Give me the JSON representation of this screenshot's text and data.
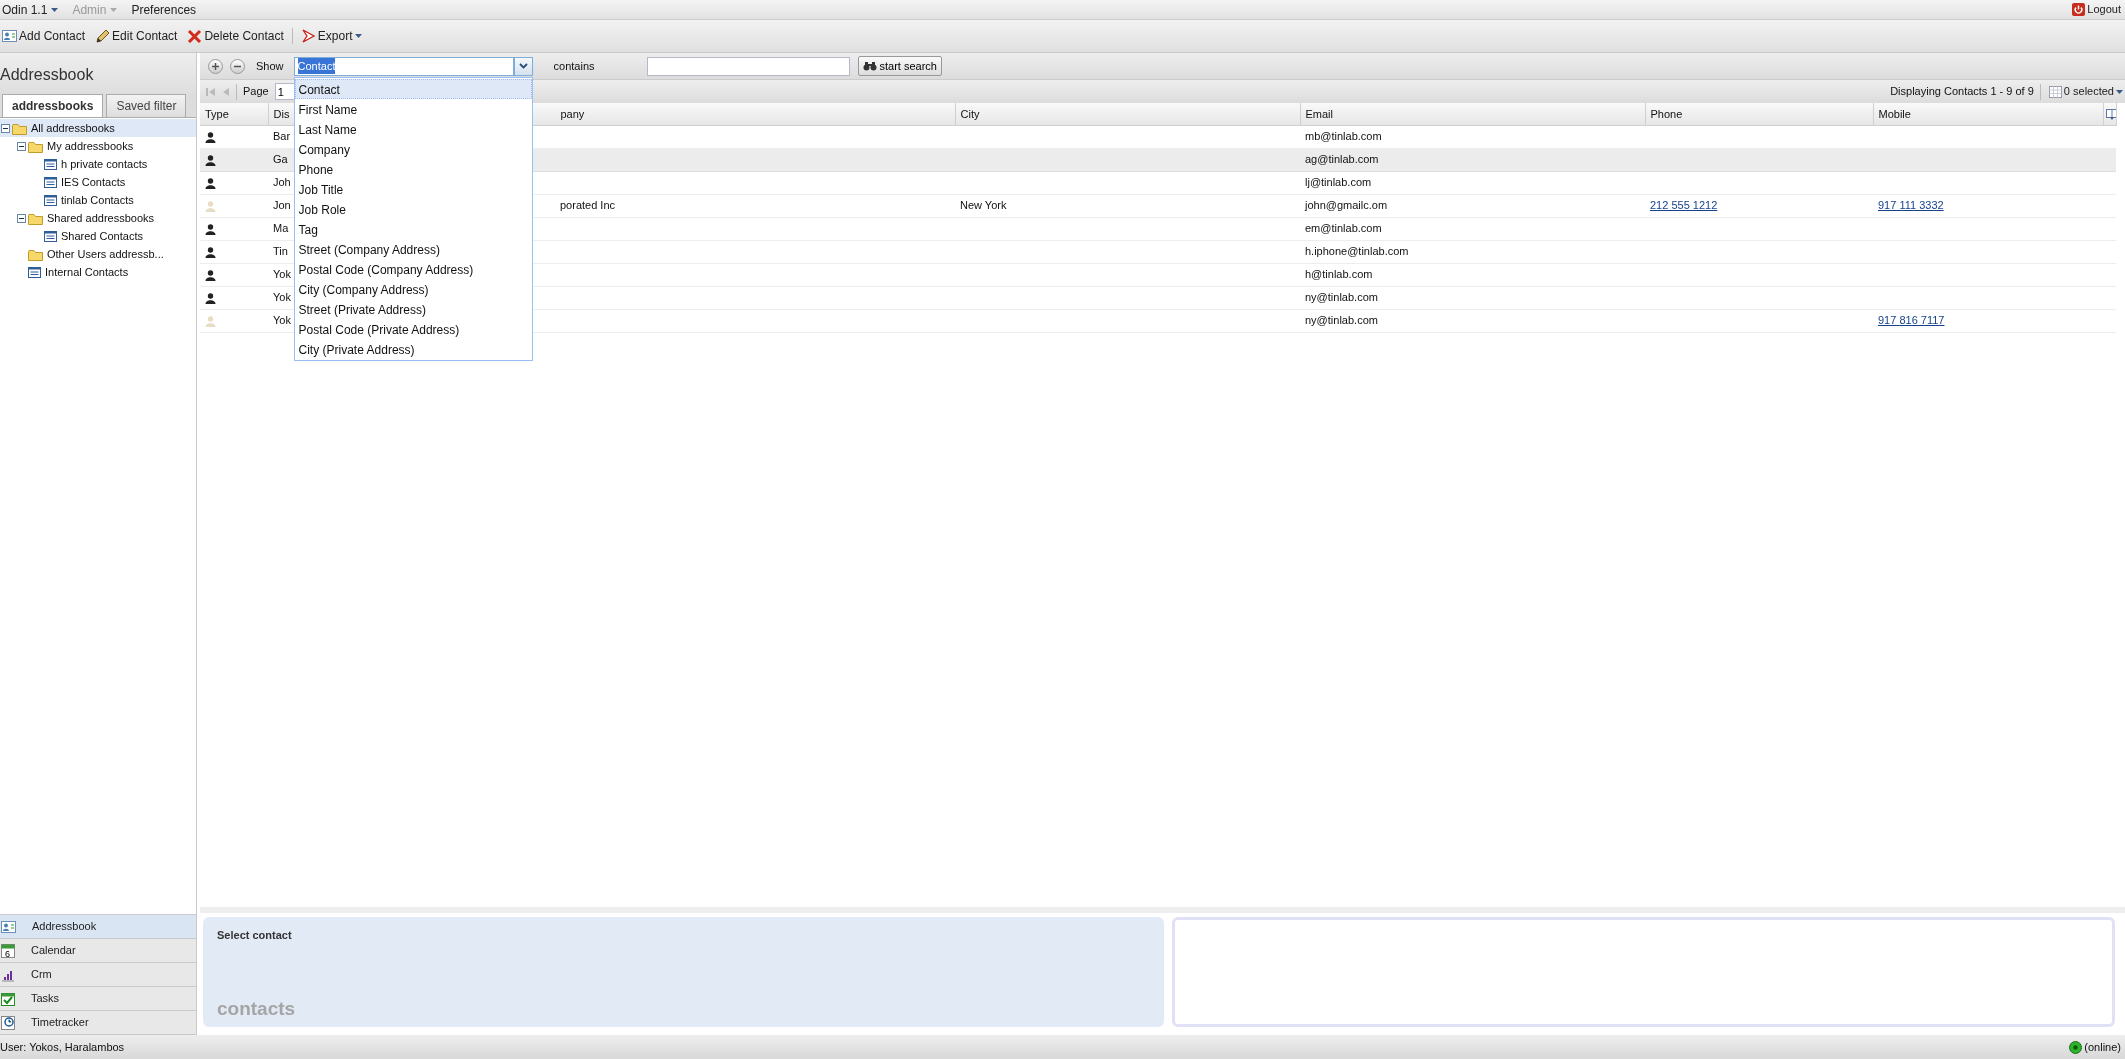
{
  "menu": [
    {
      "label": "Odin 1.1",
      "dropdown": true,
      "disabled": false
    },
    {
      "label": "Admin",
      "dropdown": true,
      "disabled": true
    },
    {
      "label": "Preferences",
      "dropdown": false,
      "disabled": false
    }
  ],
  "logout": "Logout",
  "toolbar": [
    {
      "kind": "add",
      "label": "Add Contact",
      "dropdown": false
    },
    {
      "kind": "edit",
      "label": "Edit Contact",
      "dropdown": false
    },
    {
      "kind": "delete",
      "label": "Delete Contact",
      "dropdown": false
    },
    {
      "kind": "export",
      "label": "Export",
      "dropdown": true
    }
  ],
  "sidebar": {
    "title": "Addressbook",
    "tabs": [
      {
        "label": "addressbooks",
        "selected": true
      },
      {
        "label": "Saved filter",
        "selected": false
      }
    ],
    "tree": [
      {
        "label": "All addressbooks",
        "kind": "folder",
        "expanded": true,
        "selected": true,
        "children": [
          {
            "label": "My addressbooks",
            "kind": "folder",
            "expanded": true,
            "selected": false,
            "children": [
              {
                "label": "h private contacts",
                "kind": "list",
                "selected": false
              },
              {
                "label": "IES Contacts",
                "kind": "list",
                "selected": false
              },
              {
                "label": "tinlab Contacts",
                "kind": "list",
                "selected": false
              }
            ]
          },
          {
            "label": "Shared addressbooks",
            "kind": "folder",
            "expanded": true,
            "selected": false,
            "children": [
              {
                "label": "Shared Contacts",
                "kind": "list",
                "selected": false
              }
            ]
          },
          {
            "label": "Other Users addressb...",
            "kind": "folder",
            "selected": false
          },
          {
            "label": "Internal Contacts",
            "kind": "list",
            "selected": false
          }
        ]
      }
    ],
    "modules": [
      {
        "kind": "addressbook",
        "label": "Addressbook",
        "selected": true
      },
      {
        "kind": "calendar",
        "label": "Calendar",
        "icon_text": "6",
        "selected": false
      },
      {
        "kind": "crm",
        "label": "Crm",
        "selected": false
      },
      {
        "kind": "tasks",
        "label": "Tasks",
        "selected": false
      },
      {
        "kind": "timetracker",
        "label": "Timetracker",
        "selected": false
      }
    ]
  },
  "filter": {
    "show_label": "Show",
    "field": {
      "value": "Contact",
      "options": [
        {
          "label": "Contact",
          "selected": true
        },
        {
          "label": "First Name",
          "selected": false
        },
        {
          "label": "Last Name",
          "selected": false
        },
        {
          "label": "Company",
          "selected": false
        },
        {
          "label": "Phone",
          "selected": false
        },
        {
          "label": "Job Title",
          "selected": false
        },
        {
          "label": "Job Role",
          "selected": false
        },
        {
          "label": "Tag",
          "selected": false
        },
        {
          "label": "Street (Company Address)",
          "selected": false
        },
        {
          "label": "Postal Code (Company Address)",
          "selected": false
        },
        {
          "label": "City (Company Address)",
          "selected": false
        },
        {
          "label": "Street (Private Address)",
          "selected": false
        },
        {
          "label": "Postal Code (Private Address)",
          "selected": false
        },
        {
          "label": "City (Private Address)",
          "selected": false
        }
      ]
    },
    "operator": "contains",
    "search_button": "start search"
  },
  "pager": {
    "page_label": "Page",
    "page": "1",
    "summary": "Displaying Contacts 1 - 9 of 9",
    "selection": "0 selected"
  },
  "table": {
    "columns": [
      "Type",
      "Dis",
      "pany",
      "City",
      "Email",
      "Phone",
      "Mobile"
    ],
    "rows": [
      {
        "kind": "filled",
        "selected": false,
        "cells": [
          "",
          "Bar",
          "",
          "",
          "mb@tinlab.com",
          "",
          ""
        ]
      },
      {
        "kind": "filled",
        "selected": true,
        "cells": [
          "",
          "Ga",
          "",
          "",
          "ag@tinlab.com",
          "",
          ""
        ]
      },
      {
        "kind": "filled",
        "selected": false,
        "cells": [
          "",
          "Joh",
          "",
          "",
          "lj@tinlab.com",
          "",
          ""
        ]
      },
      {
        "kind": "faded",
        "selected": false,
        "cells": [
          "",
          "Jon",
          "porated Inc",
          "New York",
          "john@gmailc.om",
          "212 555 1212",
          "917 111 3332"
        ]
      },
      {
        "kind": "filled",
        "selected": false,
        "cells": [
          "",
          "Ma",
          "",
          "",
          "em@tinlab.com",
          "",
          ""
        ]
      },
      {
        "kind": "filled",
        "selected": false,
        "cells": [
          "",
          "Tin",
          "",
          "",
          "h.iphone@tinlab.com",
          "",
          ""
        ]
      },
      {
        "kind": "filled",
        "selected": false,
        "cells": [
          "",
          "Yok",
          "",
          "",
          "h@tinlab.com",
          "",
          ""
        ]
      },
      {
        "kind": "filled",
        "selected": false,
        "cells": [
          "",
          "Yok",
          "",
          "",
          "ny@tinlab.com",
          "",
          ""
        ]
      },
      {
        "kind": "faded",
        "selected": false,
        "cells": [
          "",
          "Yok",
          "",
          "",
          "ny@tinlab.com",
          "",
          "917 816 7117"
        ]
      }
    ]
  },
  "details": {
    "title": "Select contact",
    "watermark": "contacts"
  },
  "status": {
    "user": "User: Yokos, Haralambos",
    "connection": "(online)",
    "online": true
  }
}
